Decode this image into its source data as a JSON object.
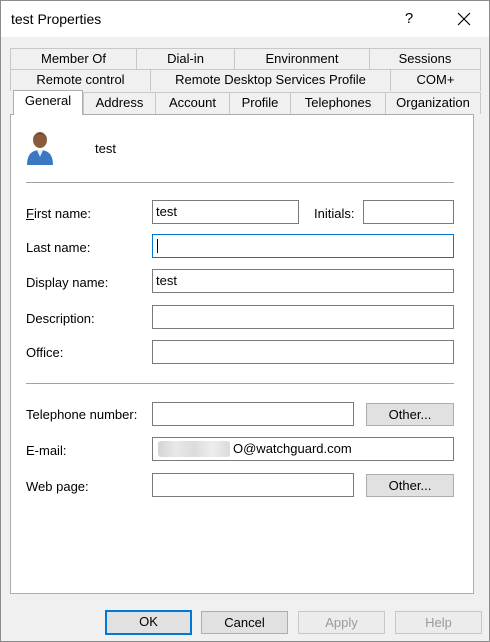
{
  "window": {
    "title": "test Properties",
    "help_glyph": "?",
    "close_icon": "close-icon"
  },
  "tabs": {
    "row1": [
      "Member Of",
      "Dial-in",
      "Environment",
      "Sessions"
    ],
    "row2": [
      "Remote control",
      "Remote Desktop Services Profile",
      "COM+"
    ],
    "row3": [
      "General",
      "Address",
      "Account",
      "Profile",
      "Telephones",
      "Organization"
    ],
    "active": "General"
  },
  "general": {
    "user_icon": "user-icon",
    "user_name": "test",
    "first_name_label": "First name:",
    "first_name_value": "test",
    "initials_label": "Initials:",
    "initials_value": "",
    "last_name_label": "Last name:",
    "last_name_value": "",
    "display_name_label": "Display name:",
    "display_name_value": "test",
    "description_label": "Description:",
    "description_value": "",
    "office_label": "Office:",
    "office_value": "",
    "telephone_label": "Telephone number:",
    "telephone_value": "",
    "telephone_other": "Other...",
    "email_label": "E-mail:",
    "email_value": "O@watchguard.com",
    "webpage_label": "Web page:",
    "webpage_value": "",
    "webpage_other": "Other..."
  },
  "footer": {
    "ok": "OK",
    "cancel": "Cancel",
    "apply": "Apply",
    "help": "Help"
  }
}
